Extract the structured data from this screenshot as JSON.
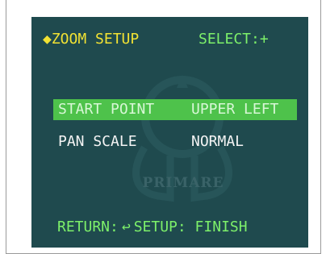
{
  "menu": {
    "title": "◆ZOOM SETUP",
    "select_hint": "SELECT:+",
    "items": [
      {
        "label": "START POINT",
        "value": "UPPER LEFT"
      },
      {
        "label": "PAN SCALE",
        "value": "NORMAL"
      }
    ],
    "footer": {
      "return_label": "RETURN:",
      "setup_label": "SETUP: FINISH"
    }
  },
  "watermark": {
    "text": "PRIMARE"
  },
  "colors": {
    "background": "#1f4a4e",
    "title": "#f2e233",
    "accent_green": "#7df06a",
    "highlight": "#4ec24b"
  }
}
